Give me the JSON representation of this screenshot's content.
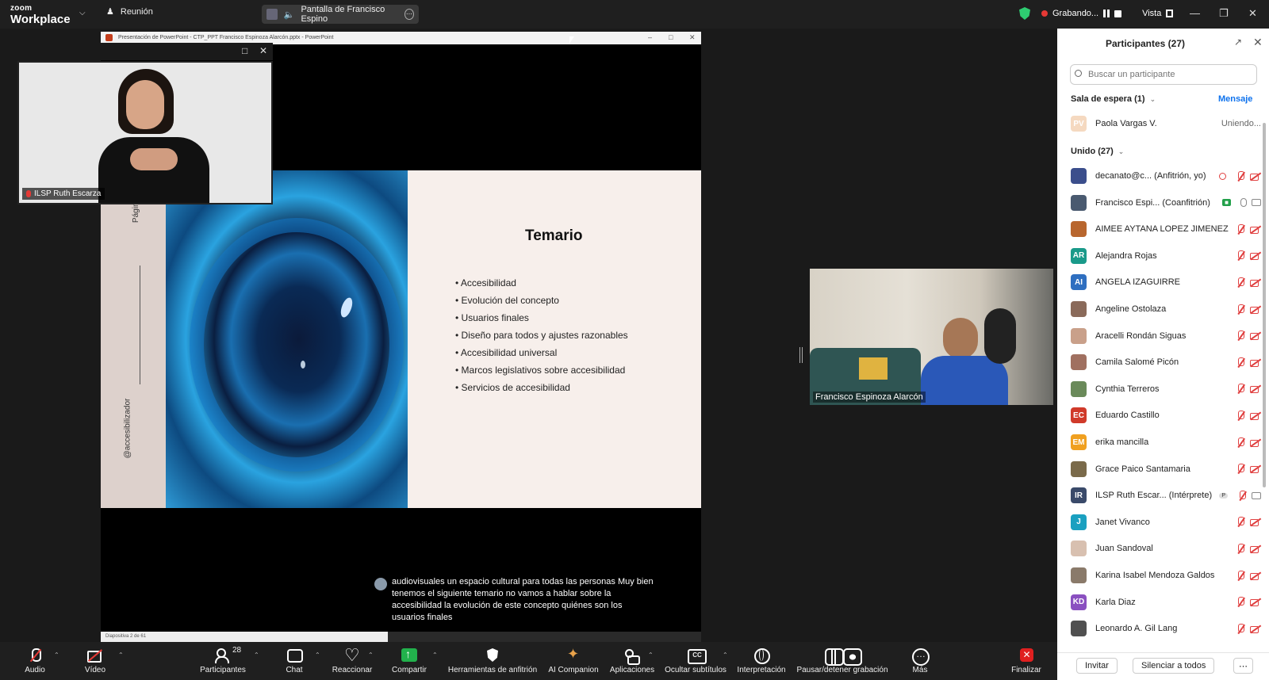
{
  "topbar": {
    "logo_line1": "zoom",
    "logo_line2": "Workplace",
    "meeting_label": "Reunión",
    "share_label": "Pantalla de Francisco Espino",
    "recording_label": "Grabando...",
    "view_label": "Vista"
  },
  "ppt": {
    "window_title": "Presentación de PowerPoint - CTP_PPT Francisco Espinoza Alarcón.pptx - PowerPoint",
    "status": "Diapositiva 2 de 61",
    "slide": {
      "side_text_top": "Página",
      "side_text_bottom": "@accesibilizador",
      "title": "Temario",
      "topics": [
        "Accesibilidad",
        "Evolución del concepto",
        "Usuarios finales",
        "Diseño para todos y ajustes razonables",
        "Accesibilidad universal",
        "Marcos legislativos sobre accesibilidad",
        "Servicios de accesibilidad"
      ]
    },
    "caption": "audiovisuales un espacio cultural para todas las personas Muy bien tenemos el siguiente temario no vamos a hablar sobre la accesibilidad la evolución de este concepto quiénes son los usuarios finales"
  },
  "videos": {
    "interpreter_name": "ILSP Ruth Escarza",
    "speaker_name": "Francisco Espinoza Alarcón"
  },
  "panel": {
    "title": "Participantes (27)",
    "search_placeholder": "Buscar un participante",
    "waiting_label": "Sala de espera (1)",
    "message_label": "Mensaje",
    "waiting": [
      {
        "name": "Paola Vargas V.",
        "initials": "PV",
        "color": "#f5d9c0",
        "status": "Uniendo..."
      }
    ],
    "joined_label": "Unido (27)",
    "joined": [
      {
        "name": "decanato@c...  (Anfitrión, yo)",
        "initials": "",
        "color": "#3b4e8c",
        "mic": "off",
        "cam": "off",
        "rec": true
      },
      {
        "name": "Francisco Espi... (Coanfitrión)",
        "initials": "",
        "color": "#4a5a70",
        "mic": "on",
        "cam": "on",
        "tag": "green"
      },
      {
        "name": "AIMEE AYTANA LOPEZ JIMENEZ",
        "initials": "",
        "color": "#b8662e",
        "mic": "off",
        "cam": "off"
      },
      {
        "name": "Alejandra Rojas",
        "initials": "AR",
        "color": "#1a9a8a",
        "mic": "off",
        "cam": "off"
      },
      {
        "name": "ANGELA IZAGUIRRE",
        "initials": "AI",
        "color": "#2f6fc0",
        "mic": "off",
        "cam": "off"
      },
      {
        "name": "Angeline Ostolaza",
        "initials": "",
        "color": "#8a6a5a",
        "mic": "off",
        "cam": "off"
      },
      {
        "name": "Aracelli Rondán Siguas",
        "initials": "",
        "color": "#c9a08a",
        "mic": "off",
        "cam": "off"
      },
      {
        "name": "Camila Salomé Picón",
        "initials": "",
        "color": "#a07060",
        "mic": "off",
        "cam": "off"
      },
      {
        "name": "Cynthia Terreros",
        "initials": "",
        "color": "#6a8a5a",
        "mic": "off",
        "cam": "off"
      },
      {
        "name": "Eduardo Castillo",
        "initials": "EC",
        "color": "#d03a2a",
        "mic": "off",
        "cam": "off"
      },
      {
        "name": "erika mancilla",
        "initials": "EM",
        "color": "#f0a020",
        "mic": "off",
        "cam": "off"
      },
      {
        "name": "Grace Paico Santamaria",
        "initials": "",
        "color": "#7a6a4a",
        "mic": "off",
        "cam": "off"
      },
      {
        "name": "ILSP Ruth Escar... (Intérprete)",
        "initials": "IR",
        "color": "#3a4a6a",
        "mic": "off",
        "cam": "on",
        "tag": "p"
      },
      {
        "name": "Janet Vivanco",
        "initials": "J",
        "color": "#1aa0c0",
        "mic": "off",
        "cam": "off"
      },
      {
        "name": "Juan Sandoval",
        "initials": "",
        "color": "#d8c0b0",
        "mic": "off",
        "cam": "off"
      },
      {
        "name": "Karina Isabel Mendoza Galdos",
        "initials": "",
        "color": "#8a7a6a",
        "mic": "off",
        "cam": "off"
      },
      {
        "name": "Karla Diaz",
        "initials": "KD",
        "color": "#8a50c0",
        "mic": "off",
        "cam": "off"
      },
      {
        "name": "Leonardo A. Gil Lang",
        "initials": "",
        "color": "#505050",
        "mic": "off",
        "cam": "off"
      }
    ],
    "invite_label": "Invitar",
    "mute_all_label": "Silenciar a todos"
  },
  "toolbar": {
    "audio": "Audio",
    "video": "Vídeo",
    "participants": "Participantes",
    "participants_count": "28",
    "chat": "Chat",
    "react": "Reaccionar",
    "share": "Compartir",
    "host_tools": "Herramientas de anfitrión",
    "ai": "AI Companion",
    "apps": "Aplicaciones",
    "captions": "Ocultar subtítulos",
    "interpretation": "Interpretación",
    "record": "Pausar/detener grabación",
    "more": "Más",
    "end": "Finalizar"
  }
}
